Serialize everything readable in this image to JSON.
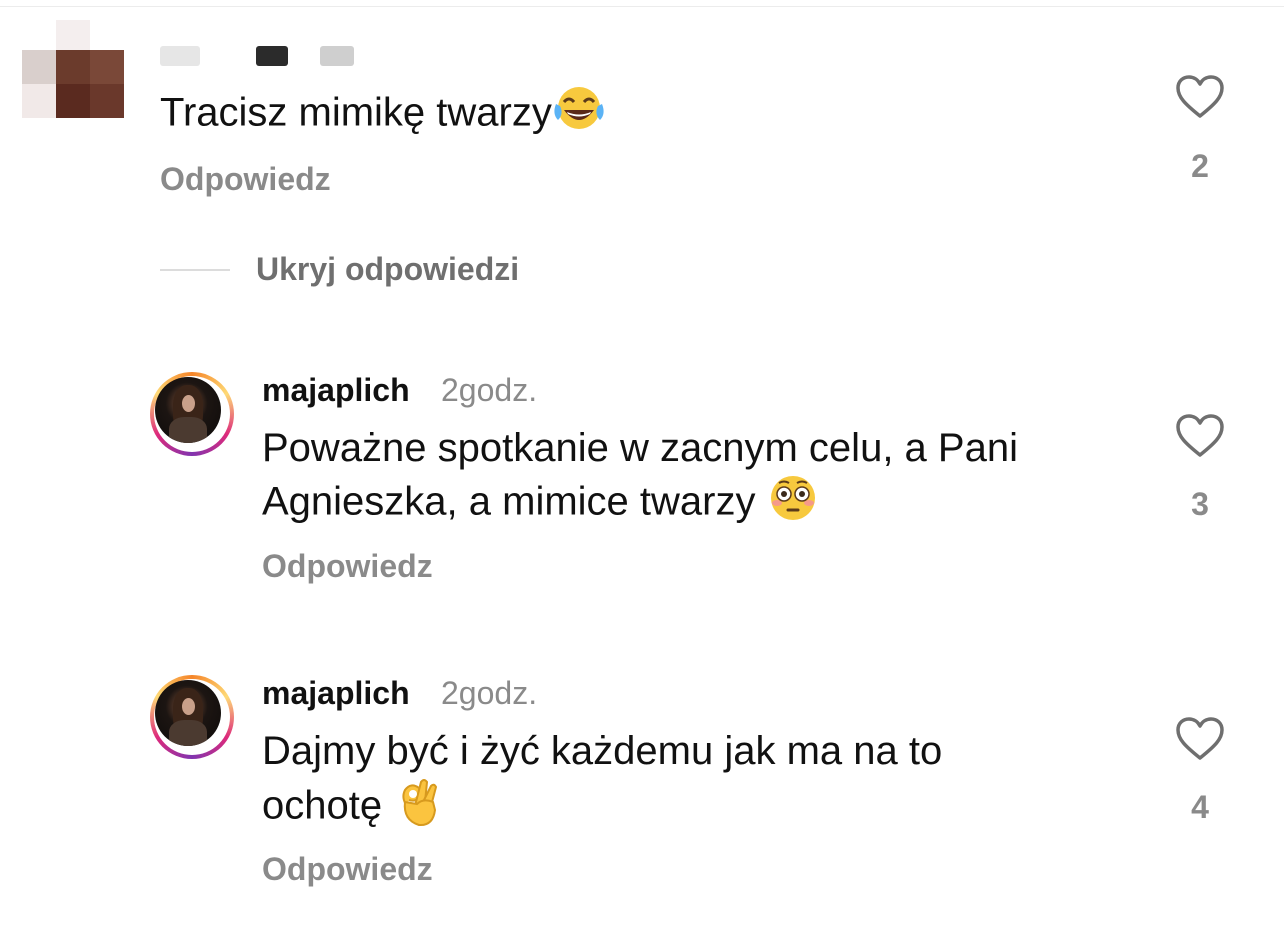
{
  "comments": [
    {
      "username": "",
      "time": "",
      "text": "Tracisz mimikę twarzy",
      "emoji": "tears-of-joy-emoji",
      "reply_label": "Odpowiedz",
      "like_count": "2"
    },
    {
      "username": "majaplich",
      "time": "2godz.",
      "text_line1": "Poważne spotkanie w zacnym celu, a Pani",
      "text_line2": "Agnieszka, a mimice twarzy",
      "emoji": "flushed-face-emoji",
      "reply_label": "Odpowiedz",
      "like_count": "3"
    },
    {
      "username": "majaplich",
      "time": "2godz.",
      "text_line1": "Dajmy być i żyć każdemu jak ma na to",
      "text_line2": "ochotę",
      "emoji": "ok-hand-emoji",
      "reply_label": "Odpowiedz",
      "like_count": "4"
    }
  ],
  "hide_replies_label": "Ukryj odpowiedzi",
  "colors": {
    "muted_text": "#8a8a8a",
    "primary_text": "#111111",
    "story_ring_start": "#f58529",
    "story_ring_end": "#dd2a7b"
  }
}
